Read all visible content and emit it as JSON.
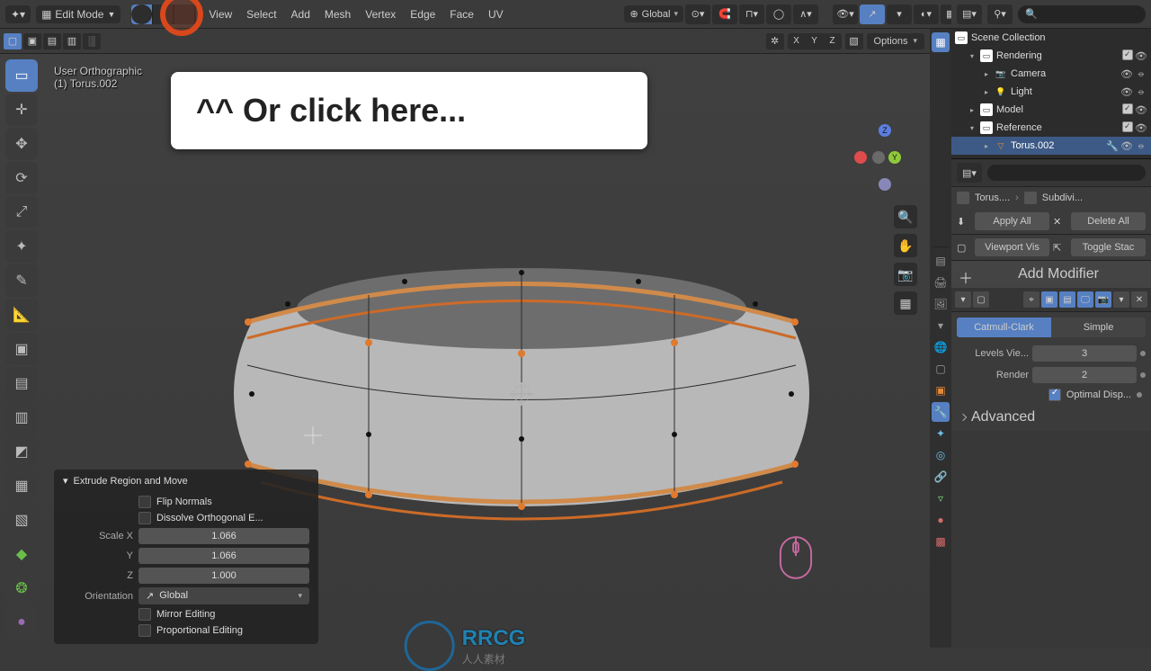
{
  "topbar": {
    "mode": "Edit Mode",
    "menus": [
      "View",
      "Select",
      "Add",
      "Mesh",
      "Vertex",
      "Edge",
      "Face",
      "UV"
    ],
    "orientation": "Global"
  },
  "secondbar": {
    "axes": [
      "X",
      "Y",
      "Z"
    ],
    "options_label": "Options"
  },
  "viewport": {
    "projection": "User Orthographic",
    "object_line": "(1) Torus.002",
    "callout": "^^ Or click here..."
  },
  "operator": {
    "title": "Extrude Region and Move",
    "rows": {
      "flip_normals": "Flip Normals",
      "dissolve": "Dissolve Orthogonal E...",
      "scale_x_label": "Scale X",
      "scale_x": "1.066",
      "y_label": "Y",
      "y": "1.066",
      "z_label": "Z",
      "z": "1.000",
      "orientation_label": "Orientation",
      "orientation": "Global",
      "mirror": "Mirror Editing",
      "proportional": "Proportional Editing"
    }
  },
  "outliner": {
    "root": "Scene Collection",
    "rendering": "Rendering",
    "camera": "Camera",
    "light": "Light",
    "model": "Model",
    "reference": "Reference",
    "torus": "Torus.002"
  },
  "properties": {
    "bc_obj": "Torus....",
    "bc_mod": "Subdivi...",
    "apply_all": "Apply All",
    "delete_all": "Delete All",
    "viewport_vis": "Viewport Vis",
    "toggle_stack": "Toggle Stac",
    "add_modifier": "Add Modifier",
    "tab_cc": "Catmull-Clark",
    "tab_simple": "Simple",
    "levels_label": "Levels Vie...",
    "levels_val": "3",
    "render_label": "Render",
    "render_val": "2",
    "optimal": "Optimal Disp...",
    "advanced": "Advanced"
  },
  "watermark": {
    "brand": "RRCG",
    "sub": "人人素材"
  }
}
